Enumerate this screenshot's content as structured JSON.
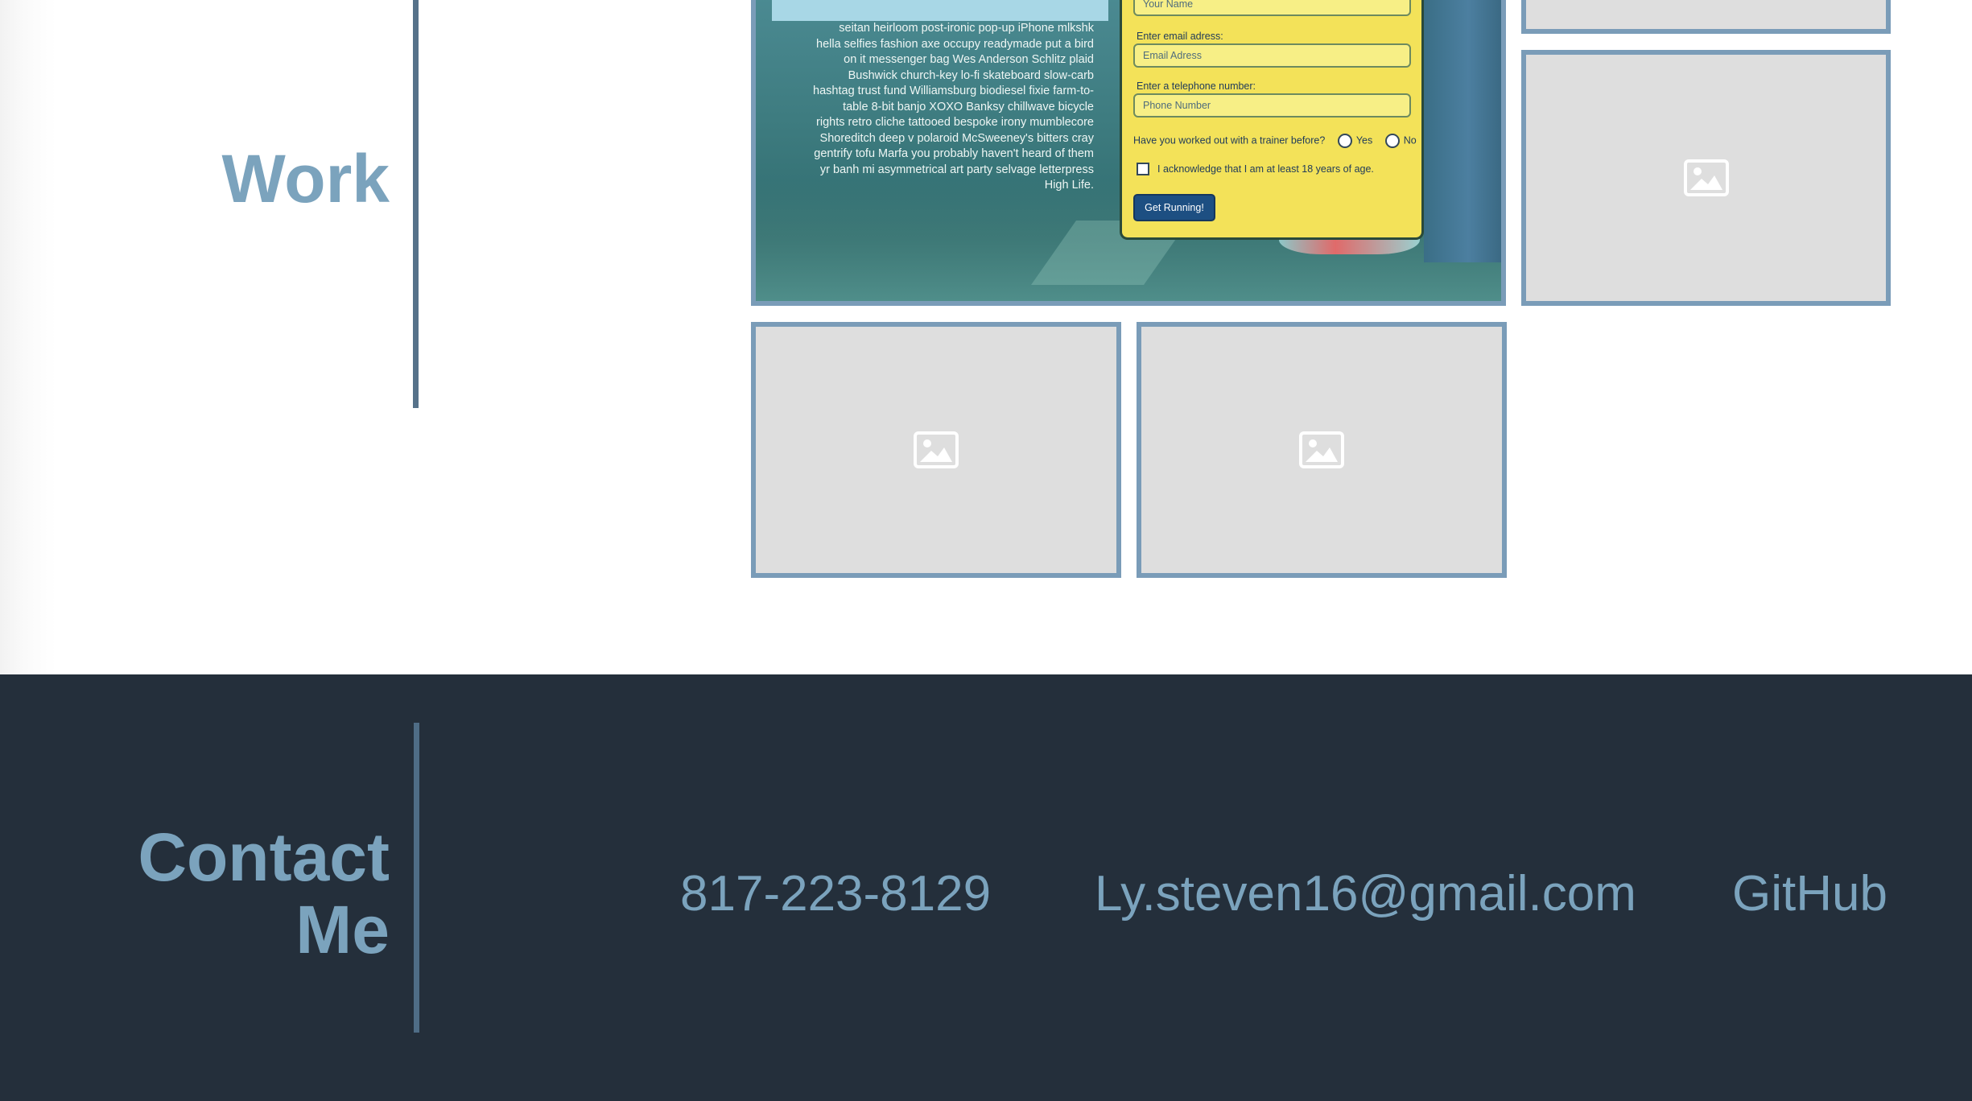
{
  "work": {
    "title": "Work",
    "featured_project": {
      "description": "seitan heirloom post-ironic pop-up iPhone mlkshk hella selfies fashion axe occupy readymade put a bird on it messenger bag Wes Anderson Schlitz plaid Bushwick church-key lo-fi skateboard slow-carb hashtag trust fund Williamsburg biodiesel fixie farm-to-table 8-bit banjo XOXO Banksy chillwave bicycle rights retro cliche tattooed bespoke irony mumblecore Shoreditch deep v polaroid McSweeney's bitters cray gentrify tofu Marfa you probably haven't heard of them yr banh mi asymmetrical art party selvage letterpress High Life.",
      "form": {
        "name_placeholder": "Your Name",
        "email_label": "Enter email adress:",
        "email_placeholder": "Email Adress",
        "phone_label": "Enter a telephone number:",
        "phone_placeholder": "Phone Number",
        "trainer_question": "Have you worked out with a trainer before?",
        "radio_yes": "Yes",
        "radio_no": "No",
        "age_ack": "I acknowledge that I am at least 18 years of age.",
        "submit_label": "Get Running!"
      }
    },
    "placeholder_icon": "image-placeholder-icon"
  },
  "contact": {
    "title_line1": "Contact",
    "title_line2": "Me",
    "phone": "817-223-8129",
    "email": "Ly.steven16@gmail.com",
    "github": "GitHub"
  },
  "colors": {
    "accent": "#7ba3bd",
    "contact_bg": "#242f3b",
    "tile_border": "#7a9cb8",
    "tile_bg": "#dedede"
  }
}
